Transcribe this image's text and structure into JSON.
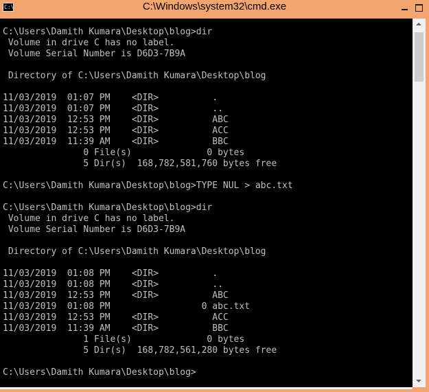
{
  "window": {
    "title": "C:\\Windows\\system32\\cmd.exe",
    "icon_text": "C:\\"
  },
  "console": {
    "lines": [
      "C:\\Users\\Damith Kumara\\Desktop\\blog>dir",
      " Volume in drive C has no label.",
      " Volume Serial Number is D6D3-7B9A",
      "",
      " Directory of C:\\Users\\Damith Kumara\\Desktop\\blog",
      "",
      "11/03/2019  01:07 PM    <DIR>          .",
      "11/03/2019  01:07 PM    <DIR>          ..",
      "11/03/2019  12:53 PM    <DIR>          ABC",
      "11/03/2019  12:53 PM    <DIR>          ACC",
      "11/03/2019  11:39 AM    <DIR>          BBC",
      "               0 File(s)              0 bytes",
      "               5 Dir(s)  168,782,581,760 bytes free",
      "",
      "C:\\Users\\Damith Kumara\\Desktop\\blog>TYPE NUL > abc.txt",
      "",
      "C:\\Users\\Damith Kumara\\Desktop\\blog>dir",
      " Volume in drive C has no label.",
      " Volume Serial Number is D6D3-7B9A",
      "",
      " Directory of C:\\Users\\Damith Kumara\\Desktop\\blog",
      "",
      "11/03/2019  01:08 PM    <DIR>          .",
      "11/03/2019  01:08 PM    <DIR>          ..",
      "11/03/2019  12:53 PM    <DIR>          ABC",
      "11/03/2019  01:08 PM                 0 abc.txt",
      "11/03/2019  12:53 PM    <DIR>          ACC",
      "11/03/2019  11:39 AM    <DIR>          BBC",
      "               1 File(s)              0 bytes",
      "               5 Dir(s)  168,782,561,280 bytes free",
      "",
      "C:\\Users\\Damith Kumara\\Desktop\\blog>"
    ]
  }
}
